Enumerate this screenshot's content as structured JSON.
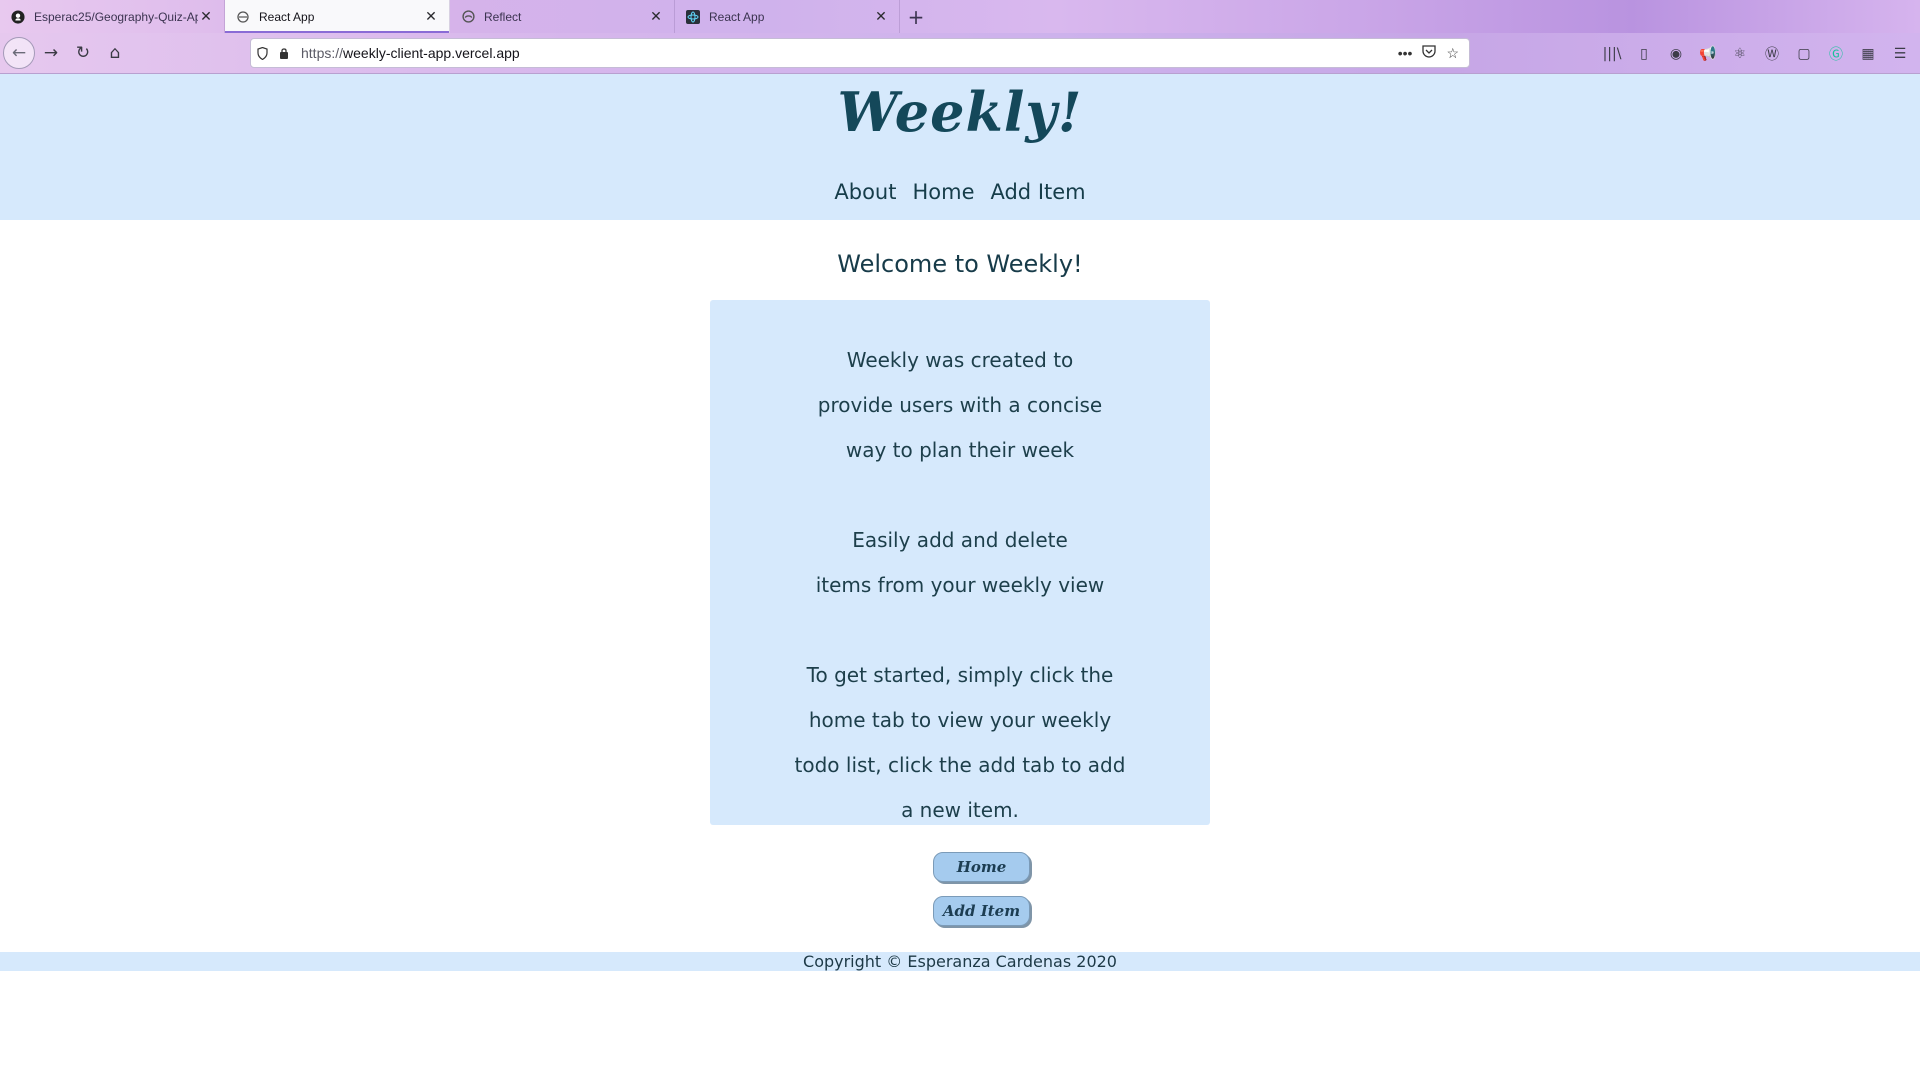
{
  "browser": {
    "tabs": [
      {
        "title": "Esperac25/Geography-Quiz-Ap",
        "icon": "github-icon",
        "active": false
      },
      {
        "title": "React App",
        "icon": "page-icon",
        "active": true
      },
      {
        "title": "Reflect",
        "icon": "reflect-icon",
        "active": false
      },
      {
        "title": "React App",
        "icon": "react-icon",
        "active": false
      }
    ],
    "url_scheme": "https://",
    "url_host": "weekly-client-app.vercel.app"
  },
  "site": {
    "logo": "Weekly!",
    "nav": [
      "About",
      "Home",
      "Add Item"
    ],
    "welcome": "Welcome to Weekly!",
    "paragraphs": [
      [
        "Weekly was created to",
        "provide users with a concise",
        "way to plan their week"
      ],
      [
        "Easily add and delete",
        "items from your weekly view"
      ],
      [
        "To get started, simply click the",
        "home tab to view your weekly",
        "todo list, click the add tab to add",
        "a new item."
      ]
    ],
    "buttons": {
      "home": "Home",
      "add": "Add Item"
    },
    "footer": "Copyright © Esperanza Cardenas 2020"
  },
  "colors": {
    "header_bg": "#d6e9fc",
    "text_dark": "#14485a",
    "button_bg": "#a5cbee"
  }
}
